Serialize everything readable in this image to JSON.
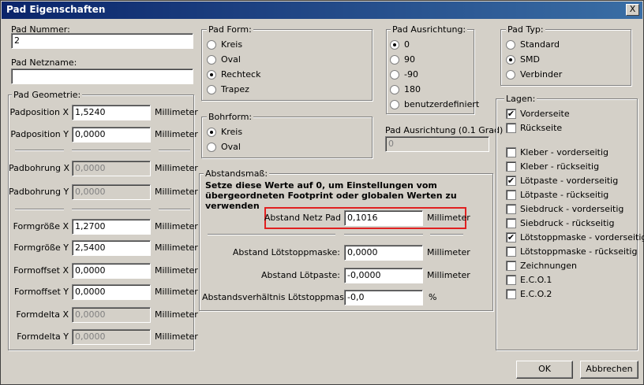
{
  "window": {
    "title": "Pad Eigenschaften",
    "close": "X"
  },
  "pad_nummer": {
    "label": "Pad Nummer:",
    "value": "2"
  },
  "pad_netzname": {
    "label": "Pad Netzname:",
    "value": ""
  },
  "geometry": {
    "title": "Pad Geometrie:",
    "unit": "Millimeter",
    "rows": [
      {
        "label": "Padposition X",
        "value": "1,5240"
      },
      {
        "label": "Padposition Y",
        "value": "0,0000"
      },
      {
        "label": "Padbohrung X",
        "value": "0,0000"
      },
      {
        "label": "Padbohrung Y",
        "value": "0,0000"
      },
      {
        "label": "Formgröße X",
        "value": "1,2700"
      },
      {
        "label": "Formgröße Y",
        "value": "2,5400"
      },
      {
        "label": "Formoffset X",
        "value": "0,0000"
      },
      {
        "label": "Formoffset Y",
        "value": "0,0000"
      },
      {
        "label": "Formdelta X",
        "value": "0,0000"
      },
      {
        "label": "Formdelta Y",
        "value": "0,0000"
      }
    ]
  },
  "pad_form": {
    "title": "Pad Form:",
    "options": [
      "Kreis",
      "Oval",
      "Rechteck",
      "Trapez"
    ]
  },
  "bohrform": {
    "title": "Bohrform:",
    "options": [
      "Kreis",
      "Oval"
    ]
  },
  "ausrichtung": {
    "title": "Pad Ausrichtung:",
    "options": [
      "0",
      "90",
      "-90",
      "180",
      "benutzerdefiniert"
    ],
    "custom_label": "Pad Ausrichtung (0.1 Grad)",
    "custom_value": "0"
  },
  "pad_typ": {
    "title": "Pad Typ:",
    "options": [
      "Standard",
      "SMD",
      "Verbinder"
    ]
  },
  "lagen": {
    "title": "Lagen:",
    "items": [
      "Vorderseite",
      "Rückseite",
      "Kleber - vorderseitig",
      "Kleber - rückseitig",
      "Lötpaste - vorderseitig",
      "Lötpaste - rückseitig",
      "Siebdruck - vorderseitig",
      "Siebdruck - rückseitig",
      "Lötstoppmaske - vorderseitig",
      "Lötstoppmaske - rückseitig",
      "Zeichnungen",
      "E.C.O.1",
      "E.C.O.2"
    ]
  },
  "abstand": {
    "title": "Abstandsmaß:",
    "hint": "Setze diese Werte auf 0, um Einstellungen vom übergeordneten Footprint oder globalen Werten zu verwenden",
    "netz_label": "Abstand Netz Pad",
    "netz_value": "0,1016",
    "netz_unit": "Millimeter",
    "loetstopp_label": "Abstand Lötstoppmaske:",
    "loetstopp_value": "0,0000",
    "loetstopp_unit": "Millimeter",
    "loetpaste_label": "Abstand Lötpaste:",
    "loetpaste_value": "-0,0000",
    "loetpaste_unit": "Millimeter",
    "verh_label": "Abstandsverhältnis Lötstoppmaske:",
    "verh_value": "-0,0",
    "verh_unit": "%"
  },
  "buttons": {
    "ok": "OK",
    "cancel": "Abbrechen"
  }
}
